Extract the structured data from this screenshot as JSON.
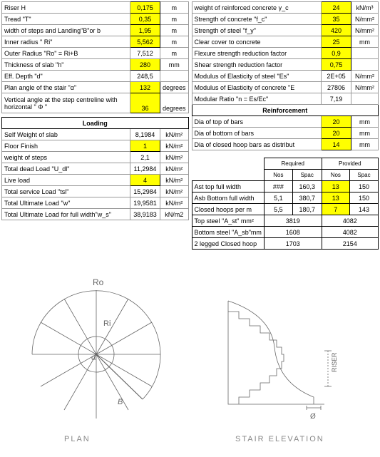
{
  "left": {
    "r0": {
      "label": "Riser  H",
      "val": "0,175",
      "unit": "m"
    },
    "tread": {
      "label": "Tread \"T\"",
      "val": "0,35",
      "unit": "m"
    },
    "width": {
      "label": "width of steps and Landing\"B\"or b",
      "val": "1,95",
      "unit": "m"
    },
    "ri": {
      "label": "Inner radius \" Ri\"",
      "val": "5,562",
      "unit": "m"
    },
    "ro": {
      "label": "Outer Radius \"Ro\" = Ri+B",
      "val": "7,512",
      "unit": "m"
    },
    "th": {
      "label": "Thickness of slab \"h\"",
      "val": "280",
      "unit": "mm"
    },
    "ed": {
      "label": "Eff. Depth \"d\"",
      "val": "248,5",
      "unit": ""
    },
    "pa": {
      "label": "Plan angle of the stair \"α\"",
      "val": "132",
      "unit": "degrees"
    },
    "va": {
      "label": "Vertical angle at the step centreline with horizontal \" Φ \"",
      "val": "36",
      "unit": "degrees"
    },
    "loading": "Loading",
    "sw": {
      "label": "Self Weight of slab",
      "val": "8,1984",
      "unit": "kN/m²"
    },
    "ff": {
      "label": "Floor Finish",
      "val": "1",
      "unit": "kN/m²"
    },
    "ws": {
      "label": "weight of steps",
      "val": "2,1",
      "unit": "kN/m²"
    },
    "tdl": {
      "label": "Total dead Load \"U_dl\"",
      "val": "11,2984",
      "unit": "kN/m²"
    },
    "ll": {
      "label": "Live load",
      "val": "4",
      "unit": "kN/m²"
    },
    "tsl": {
      "label": "Total service Load \"tsl\"",
      "val": "15,2984",
      "unit": "kN/m²"
    },
    "tul": {
      "label": "Total Ultimate Load \"w\"",
      "val": "19,9581",
      "unit": "kN/m²"
    },
    "tulf": {
      "label": "Total Ultimate Load for full width\"w_s\"",
      "val": "38,9183",
      "unit": "kN/m2"
    }
  },
  "right": {
    "wrc": {
      "label": "weight of reinforced concrete  γ_c",
      "val": "24",
      "unit": "kN/m³"
    },
    "fc": {
      "label": "Strength of concrete \"f_c\"",
      "val": "35",
      "unit": "N/mm²"
    },
    "fy": {
      "label": "Strength of steel \"f_y\"",
      "val": "420",
      "unit": "N/mm²"
    },
    "cc": {
      "label": "Clear cover to concrete",
      "val": "25",
      "unit": "mm"
    },
    "fsf": {
      "label": "Flexure strength reduction factor",
      "val": "0,9",
      "unit": ""
    },
    "ssf": {
      "label": "Shear strength reduction factor",
      "val": "0,75",
      "unit": ""
    },
    "es": {
      "label": " Modulus of Elasticity of steel \"Es\"",
      "val": "2E+05",
      "unit": "N/mm²"
    },
    "ec": {
      "label": "Modulus of Elasticity of concrete \"E",
      "val": "27806",
      "unit": "N/mm²"
    },
    "mr": {
      "label": "Modular Ratio \"n = Es/Ec\"",
      "val": "7,19",
      "unit": ""
    },
    "reinf": "Reinforcement",
    "dt": {
      "label": "Dia of top of bars",
      "val": "20",
      "unit": "mm"
    },
    "db": {
      "label": "Dia of bottom of bars",
      "val": "20",
      "unit": "mm"
    },
    "dc": {
      "label": "Dia of  closed hoop bars as distribut",
      "val": "14",
      "unit": "mm"
    }
  },
  "rp": {
    "h1a": "Required",
    "h1b": "Provided",
    "h2a": "Nos",
    "h2b": "Spac",
    "h2c": "Nos",
    "h2d": "Spac",
    "r1": {
      "l": "Ast top full width",
      "a": "###",
      "b": "160,3",
      "c": "13",
      "d": "150"
    },
    "r2": {
      "l": "Asb Bottom full width",
      "a": "5,1",
      "b": "380,7",
      "c": "13",
      "d": "150"
    },
    "r3": {
      "l": "Closed hoops per m",
      "a": "5,5",
      "b": "180,7",
      "c": "7",
      "d": "143"
    },
    "r4": {
      "l": "Top steel \"A_st\" mm²",
      "a": "3819",
      "b": "4082"
    },
    "r5": {
      "l": "Bottom steel \"A_sb\"mm",
      "a": "1608",
      "b": "4082"
    },
    "r6": {
      "l": "2 legged Closed hoop",
      "a": "1703",
      "b": "2154"
    }
  },
  "diag": {
    "ro": "Ro",
    "ri": "Ri",
    "b": "B",
    "alpha": "α",
    "riser": "RISER",
    "phi": "Ø",
    "plan": "PLAN",
    "elev": "STAIR   ELEVATION"
  }
}
